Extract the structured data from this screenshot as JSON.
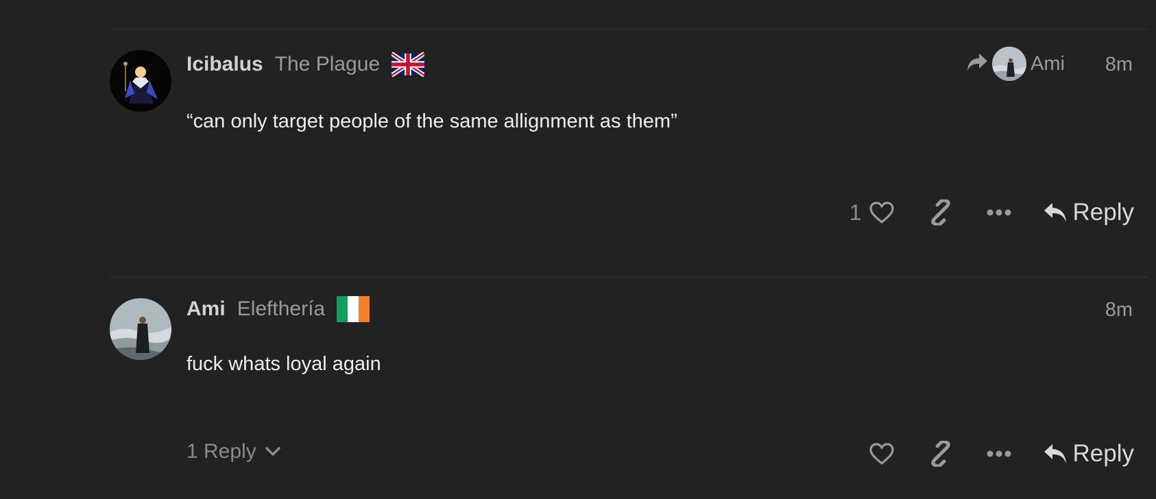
{
  "posts": [
    {
      "username": "Icibalus",
      "user_title": "The Plague",
      "flag": "united-kingdom-flag",
      "reply_to": {
        "name": "Ami"
      },
      "time": "8m",
      "body": "“can only target people of the same allignment as them”",
      "likes": "1",
      "reply_label": "Reply"
    },
    {
      "username": "Ami",
      "user_title": "Elefthería",
      "flag": "ireland-flag",
      "time": "8m",
      "body": "fuck whats loyal again",
      "replies_toggle": "1 Reply",
      "reply_label": "Reply"
    }
  ],
  "colors": {
    "background": "#222222",
    "text": "#eeeeee",
    "muted": "#9a9a9a"
  }
}
